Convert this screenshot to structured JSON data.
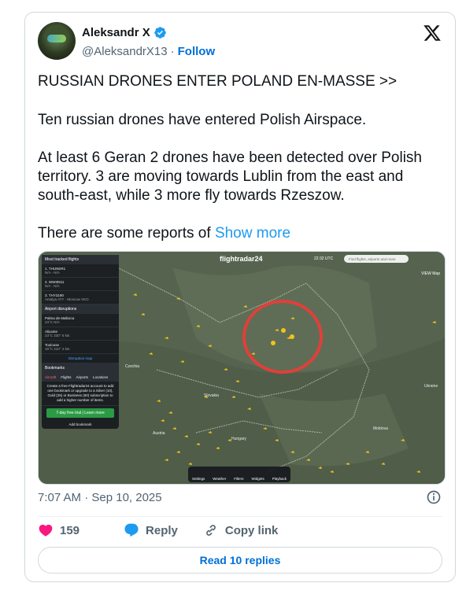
{
  "author": {
    "name": "Aleksandr X",
    "handle": "@AleksandrX13",
    "separator": "·",
    "follow_label": "Follow"
  },
  "tweet": {
    "line1": "RUSSIAN DRONES ENTER POLAND EN-MASSE >>",
    "line2": "Ten russian drones have entered Polish Airspace.",
    "line3": "At least 6 Geran 2 drones have been detected over Polish territory. 3 are moving towards Lublin from the east and south-east, while 3 more fly towards Rzeszow.",
    "line4_prefix": "There are some reports of ",
    "show_more": "Show more"
  },
  "media": {
    "logo": "flightradar24",
    "clock": "22:32 UTC",
    "search_placeholder": "Find flights, airports and more",
    "view_label": "VIEW Map",
    "panel": {
      "tracked_header": "Most tracked flights",
      "tracked": [
        {
          "flight": "1. THUNER1",
          "route": "N/A - N/A",
          "pct": "7.27%"
        },
        {
          "flight": "2. WWI0611",
          "route": "N/A - N/A",
          "pct": "1.240"
        },
        {
          "flight": "3. THY3190",
          "route": "Antalya ATY - Moscow VKO",
          "pct": "1.264"
        }
      ],
      "disruptions_header": "Airport disruptions",
      "airports": [
        {
          "name": "Palma de Mallorca",
          "weather": "23°C  N/A",
          "d1": "5.8",
          "d2": "5.6"
        },
        {
          "name": "Alicante",
          "weather": "23°C  330° 6 kts",
          "d1": "3.8",
          "d2": "2.9"
        },
        {
          "name": "Toulouse",
          "weather": "16°C  210° 4 kts",
          "d1": "2.2",
          "d2": "4.5"
        }
      ],
      "disruption_map": "Disruption map",
      "bookmarks_header": "Bookmarks",
      "tabs": [
        "Aircraft",
        "Flights",
        "Airports",
        "Locations"
      ],
      "promo": "Create a free Flightradar24 account to add one bookmark or upgrade to a Silver (10), Gold (25) or Business (60) subscription to add a higher number of items.",
      "trial_label": "7-day free trial | Learn more",
      "add_bookmark": "Add bookmark"
    },
    "countries": [
      "Czechia",
      "Slovakia",
      "Hungary",
      "Ukraine",
      "Moldova",
      "Austria"
    ],
    "bottom_bar": [
      "Settings",
      "Weather",
      "Filters",
      "Widgets",
      "Playback"
    ],
    "marker_color": "#e0403a"
  },
  "meta": {
    "time": "7:07 AM · Sep 10, 2025"
  },
  "actions": {
    "likes": "159",
    "reply_label": "Reply",
    "copy_label": "Copy link"
  },
  "read_replies": "Read 10 replies",
  "colors": {
    "accent": "#1d9bf0",
    "link": "#006fd6",
    "like": "#f91880",
    "muted": "#536471"
  }
}
